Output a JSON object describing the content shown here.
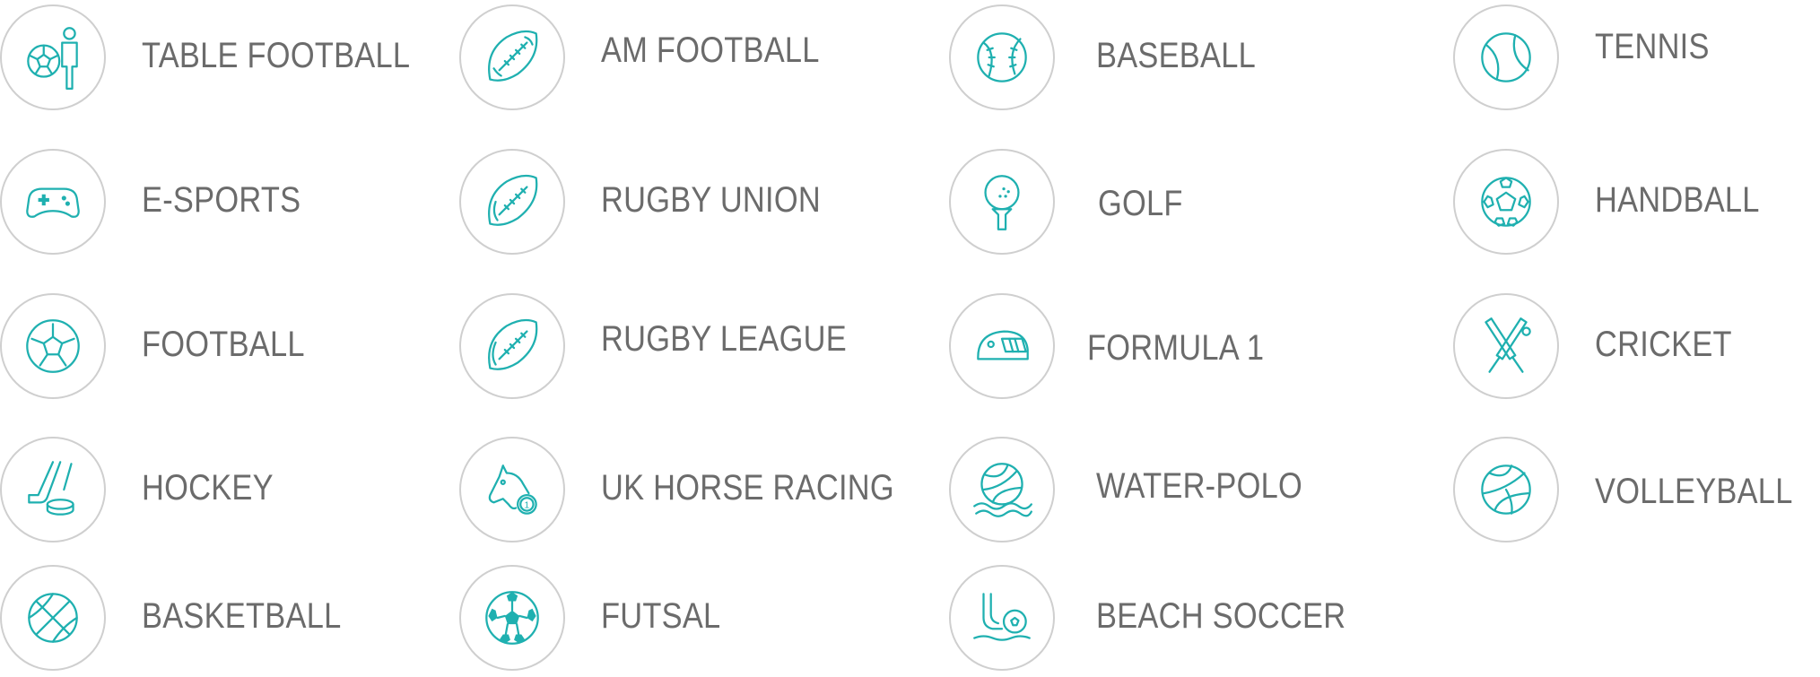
{
  "accent_color": "#1fb0b0",
  "text_color": "#6b6b6b",
  "border_color": "#cfcfcf",
  "sports": [
    {
      "label": "TABLE FOOTBALL",
      "icon": "table-football-icon"
    },
    {
      "label": "AM FOOTBALL",
      "icon": "american-football-icon"
    },
    {
      "label": "BASEBALL",
      "icon": "baseball-icon"
    },
    {
      "label": "TENNIS",
      "icon": "tennis-ball-icon"
    },
    {
      "label": "E-SPORTS",
      "icon": "gamepad-icon"
    },
    {
      "label": "RUGBY UNION",
      "icon": "rugby-ball-icon"
    },
    {
      "label": "GOLF",
      "icon": "golf-ball-on-tee-icon"
    },
    {
      "label": "HANDBALL",
      "icon": "handball-icon"
    },
    {
      "label": "FOOTBALL",
      "icon": "soccer-ball-icon"
    },
    {
      "label": "RUGBY LEAGUE",
      "icon": "rugby-league-ball-icon"
    },
    {
      "label": "FORMULA 1",
      "icon": "racing-helmet-icon"
    },
    {
      "label": "CRICKET",
      "icon": "cricket-bats-icon"
    },
    {
      "label": "HOCKEY",
      "icon": "hockey-stick-puck-icon"
    },
    {
      "label": "UK HORSE RACING",
      "icon": "horse-head-medal-icon"
    },
    {
      "label": "WATER-POLO",
      "icon": "water-polo-ball-icon"
    },
    {
      "label": "VOLLEYBALL",
      "icon": "volleyball-icon"
    },
    {
      "label": "BASKETBALL",
      "icon": "basketball-icon"
    },
    {
      "label": "FUTSAL",
      "icon": "futsal-ball-icon"
    },
    {
      "label": "BEACH SOCCER",
      "icon": "beach-soccer-icon"
    }
  ]
}
